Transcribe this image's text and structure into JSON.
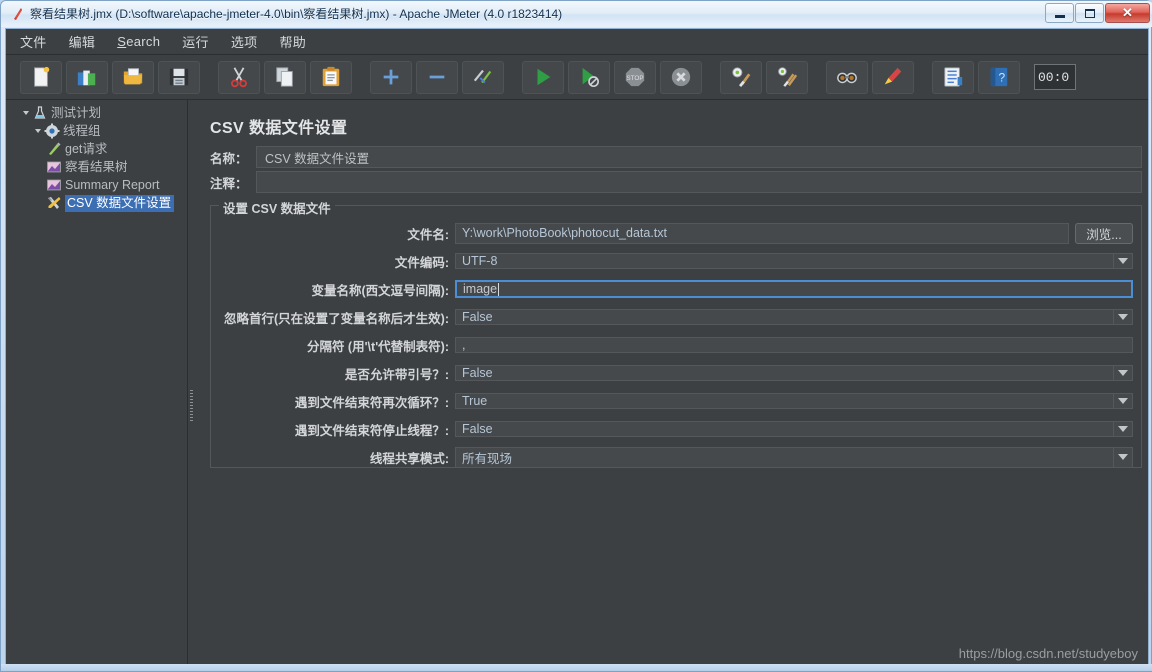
{
  "window": {
    "title": "察看结果树.jmx (D:\\software\\apache-jmeter-4.0\\bin\\察看结果树.jmx) - Apache JMeter (4.0 r1823414)",
    "app_icon": "jmeter-feather-icon",
    "controls": {
      "minimize": "minimize-button",
      "maximize": "maximize-button",
      "close": "✕"
    }
  },
  "menubar": {
    "items": [
      {
        "label": "文件",
        "mnemonic": ""
      },
      {
        "label": "编辑",
        "mnemonic": ""
      },
      {
        "label": "Search",
        "mnemonic": "S"
      },
      {
        "label": "运行",
        "mnemonic": ""
      },
      {
        "label": "选项",
        "mnemonic": ""
      },
      {
        "label": "帮助",
        "mnemonic": ""
      }
    ]
  },
  "toolbar": {
    "buttons": [
      {
        "name": "new-icon"
      },
      {
        "name": "templates-icon"
      },
      {
        "name": "open-icon"
      },
      {
        "name": "save-icon"
      },
      {
        "name": "cut-icon"
      },
      {
        "name": "copy-icon"
      },
      {
        "name": "paste-icon"
      },
      {
        "name": "expand-all-icon"
      },
      {
        "name": "collapse-all-icon"
      },
      {
        "name": "toggle-icon"
      },
      {
        "name": "start-icon"
      },
      {
        "name": "start-no-pauses-icon"
      },
      {
        "name": "stop-icon"
      },
      {
        "name": "shutdown-icon"
      },
      {
        "name": "clear-icon"
      },
      {
        "name": "clear-all-icon"
      },
      {
        "name": "search-icon"
      },
      {
        "name": "reset-search-icon"
      },
      {
        "name": "function-helper-icon"
      },
      {
        "name": "help-icon"
      }
    ],
    "timer": "00:0"
  },
  "tree": {
    "items": [
      {
        "label": "测试计划",
        "icon": "test-plan-icon",
        "indent": 0,
        "expanded": true,
        "selected": false
      },
      {
        "label": "线程组",
        "icon": "thread-group-icon",
        "indent": 1,
        "expanded": true,
        "selected": false
      },
      {
        "label": "get请求",
        "icon": "http-request-icon",
        "indent": 2,
        "expanded": false,
        "selected": false
      },
      {
        "label": "察看结果树",
        "icon": "view-results-tree-icon",
        "indent": 2,
        "expanded": false,
        "selected": false
      },
      {
        "label": "Summary Report",
        "icon": "summary-report-icon",
        "indent": 2,
        "expanded": false,
        "selected": false
      },
      {
        "label": "CSV 数据文件设置",
        "icon": "csv-data-set-icon",
        "indent": 2,
        "expanded": false,
        "selected": true
      }
    ]
  },
  "main": {
    "title": "CSV 数据文件设置",
    "name_label": "名称：",
    "name_value": "CSV 数据文件设置",
    "comment_label": "注释：",
    "comment_value": "",
    "group_legend": "设置 CSV 数据文件",
    "browse_label": "浏览...",
    "fields": [
      {
        "label": "文件名:",
        "value": "Y:\\work\\PhotoBook\\photocut_data.txt",
        "type": "text-with-browse",
        "focused": false
      },
      {
        "label": "文件编码:",
        "value": "UTF-8",
        "type": "combo",
        "focused": false
      },
      {
        "label": "变量名称(西文逗号间隔):",
        "value": "image",
        "type": "text",
        "focused": true
      },
      {
        "label": "忽略首行(只在设置了变量名称后才生效):",
        "value": "False",
        "type": "combo",
        "focused": false
      },
      {
        "label": "分隔符 (用'\\t'代替制表符):",
        "value": ",",
        "type": "text",
        "focused": false
      },
      {
        "label": "是否允许带引号？:",
        "value": "False",
        "type": "combo",
        "focused": false
      },
      {
        "label": "遇到文件结束符再次循环？:",
        "value": "True",
        "type": "combo",
        "focused": false
      },
      {
        "label": "遇到文件结束符停止线程？:",
        "value": "False",
        "type": "combo",
        "focused": false
      },
      {
        "label": "线程共享模式:",
        "value": "所有现场",
        "type": "combo",
        "focused": false
      }
    ]
  },
  "watermark": "https://blog.csdn.net/studyeboy",
  "colors": {
    "app_background": "#3c4043",
    "field_background": "#46494c",
    "field_border": "#55585b",
    "text_primary": "#d3d5d8",
    "value_text": "#b6c6d6",
    "focus_border": "#4a8ed4",
    "tree_selection": "#3c6eb4"
  }
}
